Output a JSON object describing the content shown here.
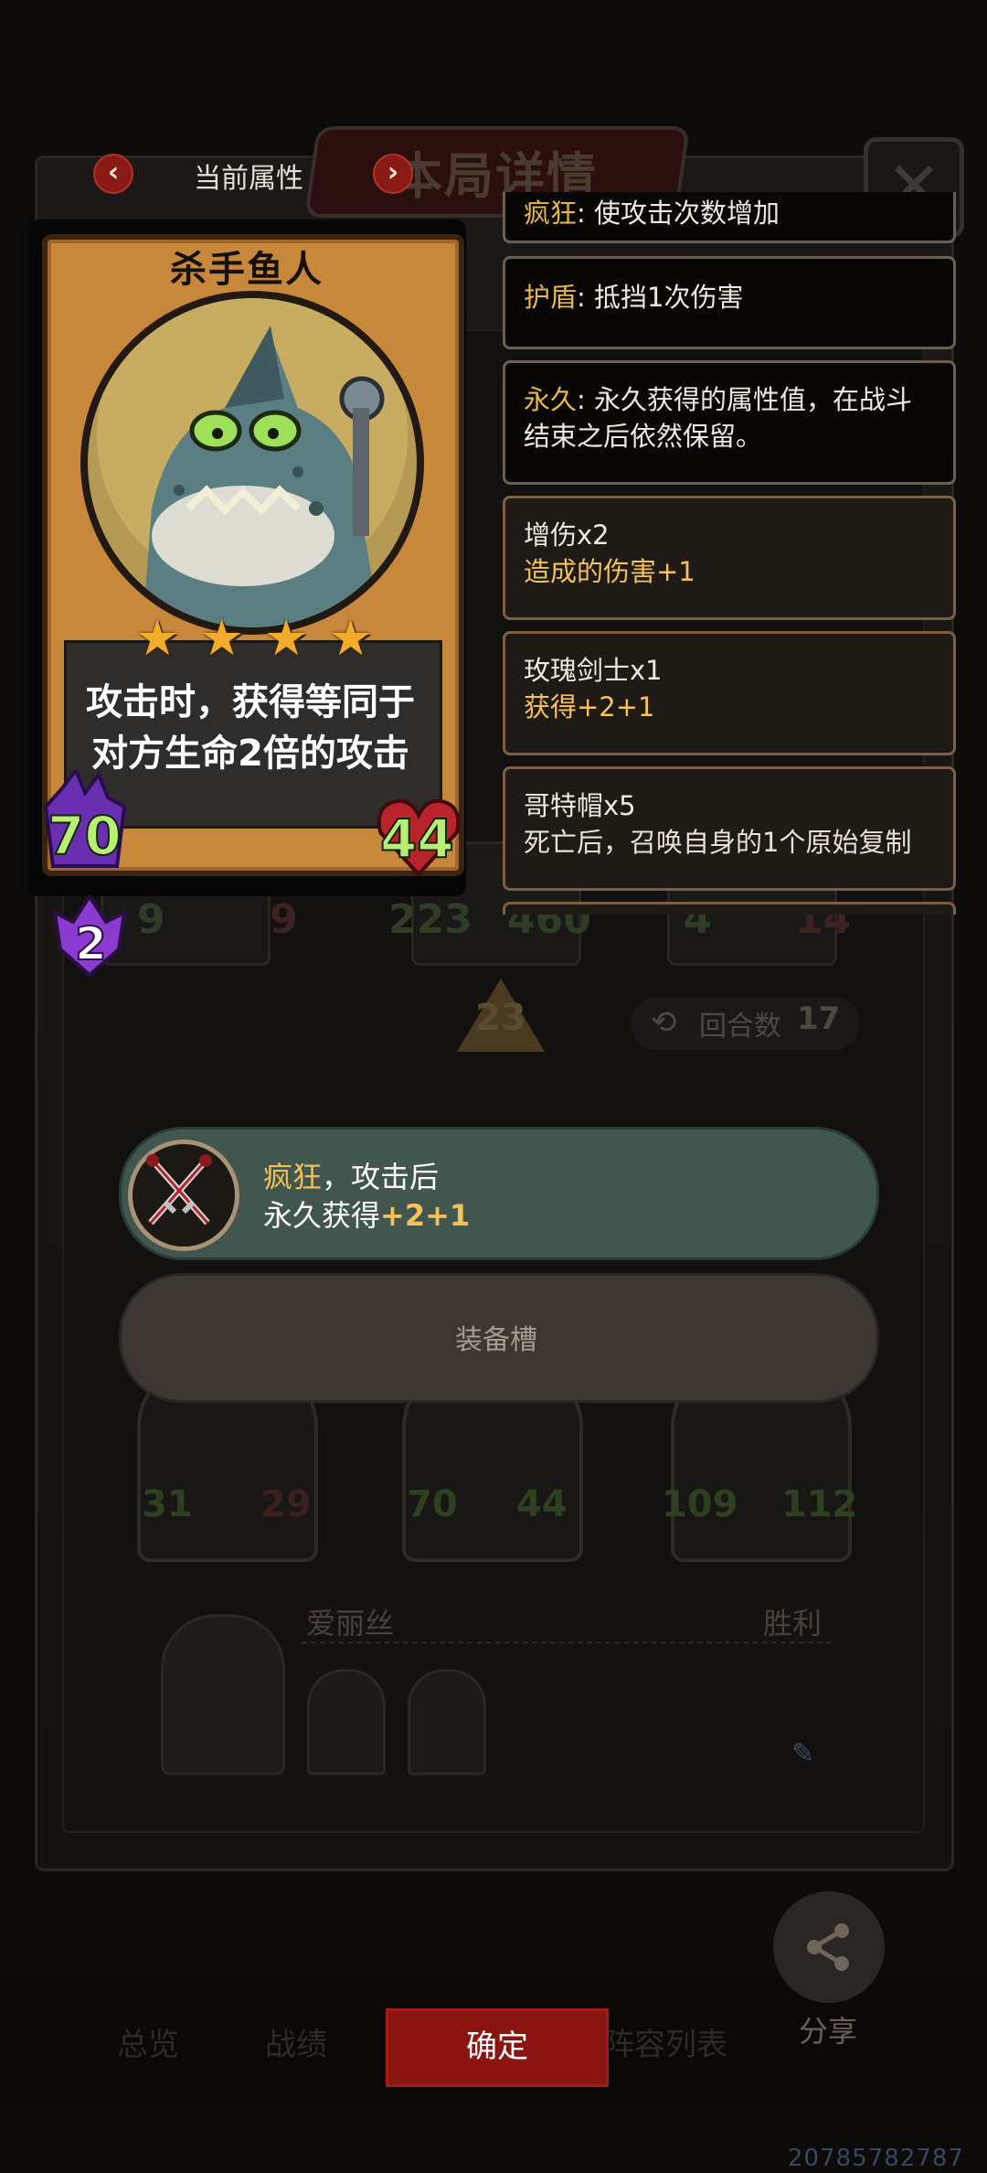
{
  "header": {
    "prev_arrow": "‹",
    "next_arrow": "›",
    "attribute_title": "当前属性",
    "panel_title": "本局详情",
    "close_label": "✕"
  },
  "unit_card": {
    "name": "杀手鱼人",
    "stars": 4,
    "ability_line1": "攻击时，获得等同于",
    "ability_line2": "对方生命2倍的攻击",
    "attack": "70",
    "health": "44",
    "level": "2"
  },
  "keywords": [
    {
      "name": "疯狂",
      "sep": ": ",
      "desc": "使攻击次数增加"
    },
    {
      "name": "护盾",
      "sep": ": ",
      "desc": "抵挡1次伤害"
    },
    {
      "name": "永久",
      "sep": ": ",
      "desc": "永久获得的属性值，在战斗结束之后依然保留。"
    }
  ],
  "buffs": [
    {
      "title": "增伤x2",
      "desc": "造成的伤害+1",
      "desc_style": "gold"
    },
    {
      "title": "玫瑰剑士x1",
      "desc": "获得+2+1",
      "desc_style": "gold"
    },
    {
      "title": "哥特帽x5",
      "desc": "死亡后，召唤自身的1个原始复制",
      "desc_style": "light"
    }
  ],
  "equipment": {
    "keyword": "疯狂",
    "line1_rest": "，攻击后",
    "line2_prefix": "永久获得",
    "line2_value": "+2+1",
    "slot_label": "装备槽"
  },
  "background": {
    "top_row_stats": [
      "9",
      "9",
      "223",
      "460",
      "4",
      "14"
    ],
    "round_number": "23",
    "turns_label": "回合数",
    "turns_count": "17",
    "board_stats": [
      "31",
      "29",
      "70",
      "44",
      "109",
      "112"
    ],
    "opponent_name": "爱丽丝",
    "result": "胜利"
  },
  "bottom_nav": {
    "tabs": [
      "总览",
      "战绩",
      "阵容列表"
    ],
    "confirm": "确定",
    "share": "分享"
  },
  "user_id": "20785782787",
  "colors": {
    "accent_red": "#8a1510",
    "gold_text": "#f4c15a",
    "stat_green": "#b8ee76",
    "equip_bg": "#41564f"
  }
}
